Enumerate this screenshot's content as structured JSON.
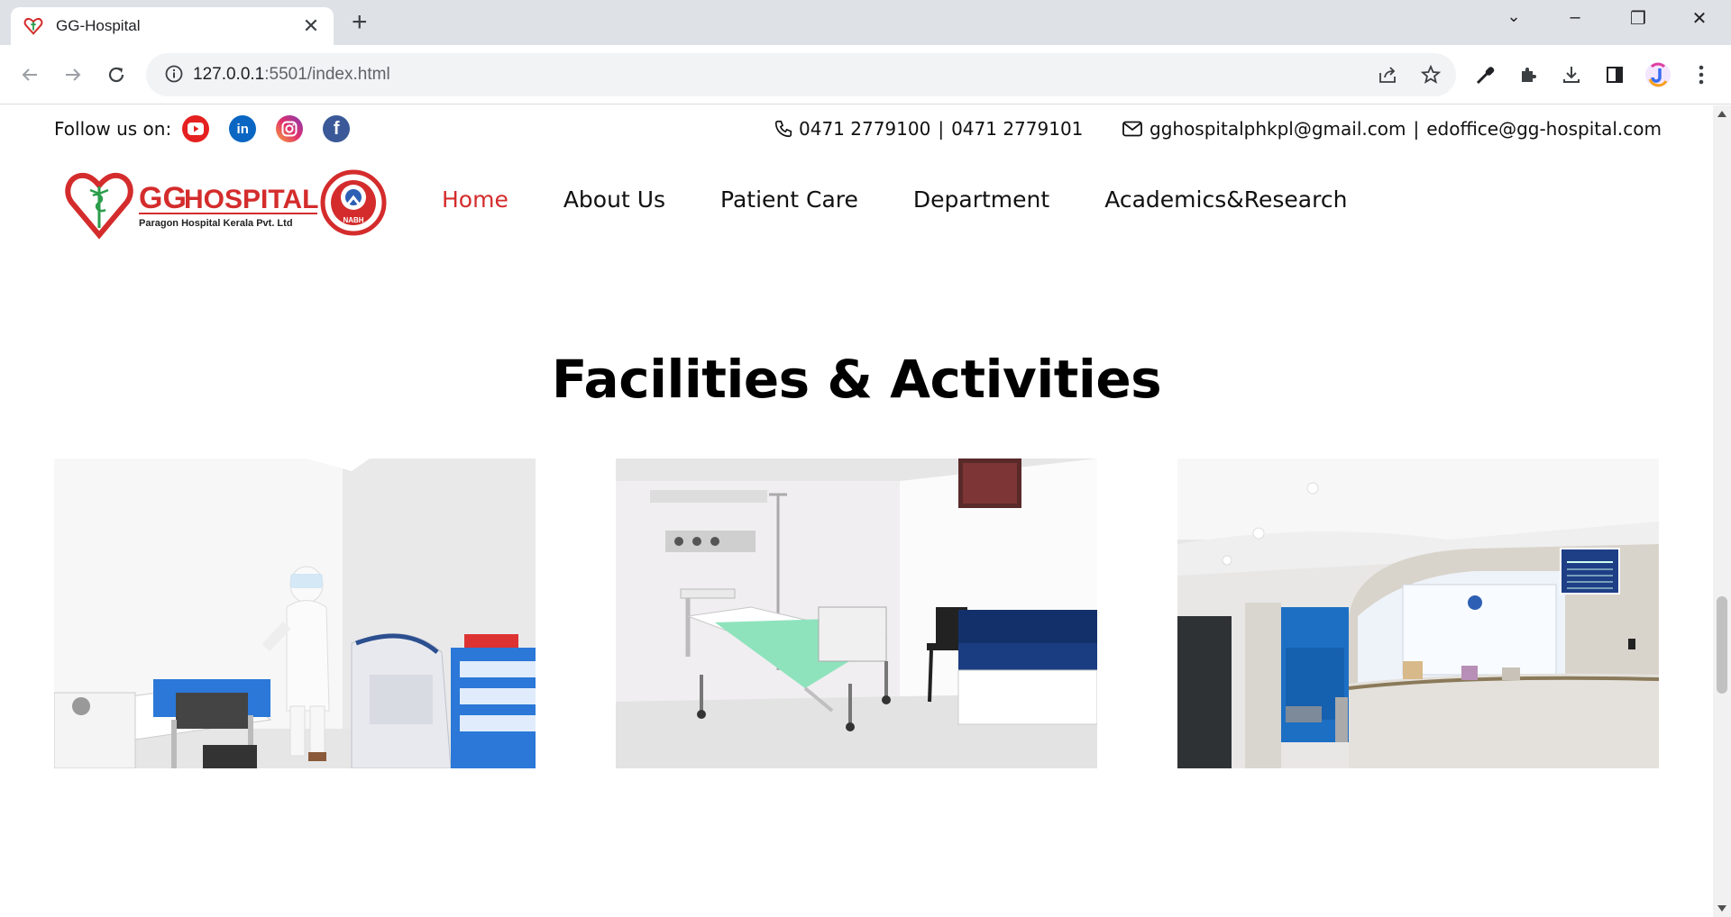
{
  "browser": {
    "tab_title": "GG-Hospital",
    "url_host": "127.0.0.1",
    "url_rest": ":5501/index.html"
  },
  "topbar": {
    "follow_label": "Follow us on:",
    "social": [
      "youtube-icon",
      "linkedin-icon",
      "instagram-icon",
      "facebook-icon"
    ],
    "phone": "0471 2779100",
    "phone_sep": "|",
    "phone2": "0471 2779101",
    "email": "gghospitalphkpl@gmail.com",
    "email_sep": "|",
    "email2": "edoffice@gg-hospital.com"
  },
  "logo": {
    "brand_gg": "GG",
    "brand_hospital": "HOSPITAL",
    "brand_sub": "Paragon Hospital Kerala Pvt. Ltd",
    "badge_text": "NABH"
  },
  "nav": {
    "items": [
      "Home",
      "About Us",
      "Patient Care",
      "Department",
      "Academics&Research"
    ],
    "active_index": 0
  },
  "section": {
    "title": "Facilities & Activities"
  },
  "colors": {
    "accent": "#d42c2c",
    "text": "#111111"
  }
}
